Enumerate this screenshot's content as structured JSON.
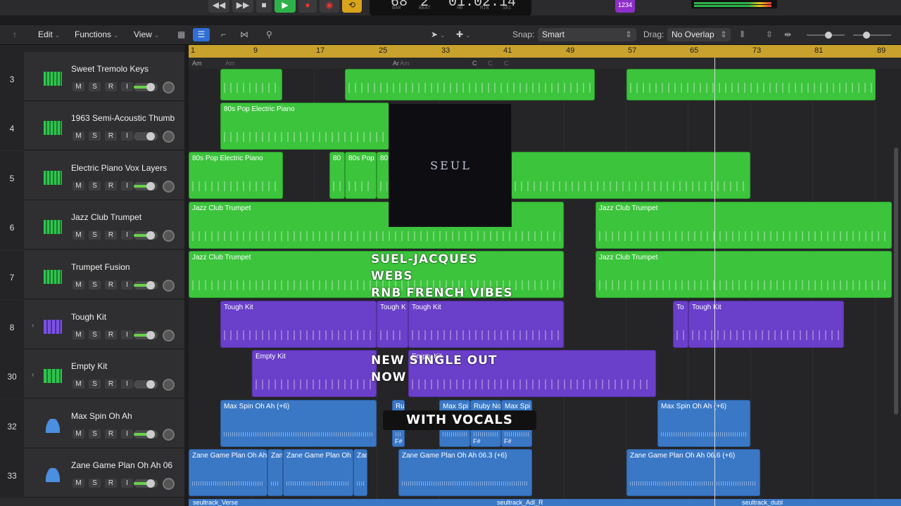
{
  "transport": {
    "bar": "68",
    "beat": "2",
    "bar_label": "BAR",
    "beat_label": "BEAT",
    "time": "01:02:14",
    "hr": "HR",
    "min": "MIN",
    "sec": "SEC",
    "badge": "1234"
  },
  "toolbar": {
    "edit": "Edit",
    "functions": "Functions",
    "view": "View",
    "snap_label": "Snap:",
    "snap_value": "Smart",
    "drag_label": "Drag:",
    "drag_value": "No Overlap"
  },
  "header_buttons": {
    "add": "+",
    "s": "S"
  },
  "ruler": [
    "1",
    "9",
    "17",
    "25",
    "33",
    "41",
    "49",
    "57",
    "65",
    "73",
    "81",
    "89"
  ],
  "markers": [
    "Am",
    "Am",
    "Ar",
    "Am",
    "C",
    "C",
    "C"
  ],
  "tracks": [
    {
      "num": "3",
      "name": "Sweet Tremolo Keys"
    },
    {
      "num": "4",
      "name": "1963 Semi-Acoustic Thumb"
    },
    {
      "num": "5",
      "name": "Electric Piano Vox Layers"
    },
    {
      "num": "6",
      "name": "Jazz Club Trumpet"
    },
    {
      "num": "7",
      "name": "Trumpet Fusion"
    },
    {
      "num": "8",
      "name": "Tough Kit"
    },
    {
      "num": "30",
      "name": "Empty Kit"
    },
    {
      "num": "32",
      "name": "Max Spin Oh Ah"
    },
    {
      "num": "33",
      "name": "Zane Game Plan Oh Ah 06"
    }
  ],
  "track_buttons": [
    "M",
    "S",
    "R",
    "I"
  ],
  "regions": {
    "r4a": "80s Pop Electric Piano",
    "r5a": "80s Pop Electric Piano",
    "r5b": "80",
    "r5c": "80s Pop",
    "r5d": "80",
    "r6a": "Jazz Club Trumpet",
    "r6b": "Jazz Club Trumpet",
    "r7a": "Jazz Club Trumpet",
    "r7b": "Jazz Club Trumpet",
    "r8a": "Tough Kit",
    "r8b": "Tough K",
    "r8c": "Tough Kit",
    "r8d": "To",
    "r8e": "Tough Kit",
    "r30a": "Empty Kit",
    "r30b": "Empty Kit",
    "r32a": "Max Spin Oh Ah (+6)",
    "r32b": "Ru",
    "r32c": "Max Spi",
    "r32d": "Ruby No",
    "r32e": "Max Spi",
    "r32f": "Max Spin Oh Ah (+6)",
    "r32g": "F#",
    "r32h": "F#",
    "r32i": "F#",
    "r33a": "Zane Game Plan Oh Ah",
    "r33b": "Zan",
    "r33c": "Zane Game Plan Oh",
    "r33d": "Zan",
    "r33e": "Zane Game Plan Oh Ah 06.3 (+6)",
    "r33f": "Zane Game Plan Oh Ah 06.6 (+6)"
  },
  "bottom": [
    "seultrack_Verse",
    "seultrack_Adl_R",
    "seultrack_dubl"
  ],
  "overlay": {
    "album": "SEUL",
    "line1": "SUEL-JACQUES",
    "line2": "WEBS",
    "line3": "RNB FRENCH VIBES",
    "line4": "NEW SINGLE OUT",
    "line5": "NOW",
    "vocals": "WITH VOCALS"
  },
  "colors": {
    "midi": "#3cc43c",
    "drum": "#6a3fc9",
    "audio": "#3a78c6",
    "ruler": "#c9a22e"
  }
}
